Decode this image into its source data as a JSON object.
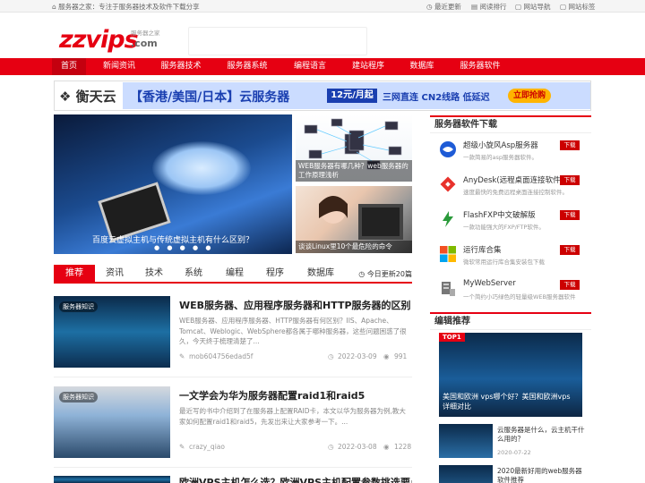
{
  "topbar": {
    "site_slogan": "服务器之家：专注于服务器技术及软件下载分享",
    "links": [
      "最近更新",
      "阅读排行",
      "网站导航",
      "网站标签"
    ]
  },
  "logo": {
    "text": "zzvips",
    "sub": "服务器之家",
    "domain": ".com"
  },
  "nav": {
    "items": [
      "首页",
      "新闻资讯",
      "服务器技术",
      "服务器系统",
      "编程语言",
      "建站程序",
      "数据库",
      "服务器软件"
    ],
    "active_index": 0
  },
  "banner": {
    "brand": "衡天云",
    "headline": "【香港/美国/日本】云服务器",
    "price": "12元/月起",
    "features": "三网直连 CN2线路 低延迟",
    "cta": "立即抢购"
  },
  "slider": {
    "main_caption": "百度云虚拟主机与传统虚拟主机有什么区别？",
    "dots": "● ● ● ● ●",
    "side": [
      {
        "caption": "WEB服务器有哪几种？web服务器的工作原理浅析"
      },
      {
        "caption": "谈谈Linux里10个最危险的命令"
      }
    ]
  },
  "tabs": {
    "items": [
      "推荐",
      "资讯",
      "技术",
      "系统",
      "编程",
      "程序",
      "数据库"
    ],
    "active_index": 0,
    "update_text": "今日更新20篇"
  },
  "articles": [
    {
      "tag": "服务器知识",
      "title": "WEB服务器、应用程序服务器和HTTP服务器的区别",
      "desc": "WEB服务器、应用程序服务器、HTTP服务器有何区别？IIS、Apache、Tomcat、Weblogic、WebSphere都各属于哪种服务器，这些问题困惑了很久，今天终于梳理清楚了...",
      "author": "mob604756edad5f",
      "date": "2022-03-09",
      "views": "991"
    },
    {
      "tag": "服务器知识",
      "title": "一文学会为华为服务器配置raid1和raid5",
      "desc": "最近写的书中介绍到了在服务器上配置RAID卡，本文以华为服务器为例,教大家如何配置raid1和raid5，先发出来让大家参考一下。...",
      "author": "crazy_qiao",
      "date": "2022-03-08",
      "views": "1228"
    },
    {
      "title": "欧洲VPS主机怎么选？欧洲VPS主机配置参数挑选要点"
    }
  ],
  "sidebar": {
    "software_title": "服务器软件下载",
    "download_label": "下载",
    "software": [
      {
        "name": "超级小旋风Asp服务器",
        "desc": "一款简易的asp服务器软件。",
        "icon": "wind-icon",
        "color": "#1e5bd6"
      },
      {
        "name": "AnyDesk(远程桌面连接软件)",
        "desc": "速度最快的免费远程桌面连接控制软件。",
        "icon": "anydesk-icon",
        "color": "#e8322c"
      },
      {
        "name": "FlashFXP中文破解版",
        "desc": "一款功能强大的FXP/FTP软件。",
        "icon": "flashfxp-icon",
        "color": "#2a9a3a"
      },
      {
        "name": "运行库合集",
        "desc": "微软常用运行库合集安装包下载",
        "icon": "windows-icon",
        "color": "#f25022"
      },
      {
        "name": "MyWebServer",
        "desc": "一个简约小巧绿色的轻量级WEB服务器软件",
        "icon": "server-icon",
        "color": "#777777"
      }
    ],
    "editor_title": "编辑推荐",
    "featured": {
      "badge": "TOP1",
      "caption": "美国和欧洲 vps哪个好？美国和欧洲vps详细对比"
    },
    "mini_items": [
      {
        "title": "云服务器是什么，云主机干什么用的？",
        "date": "2020-07-22"
      },
      {
        "title": "2020最新好用的web服务器软件推荐"
      }
    ]
  }
}
